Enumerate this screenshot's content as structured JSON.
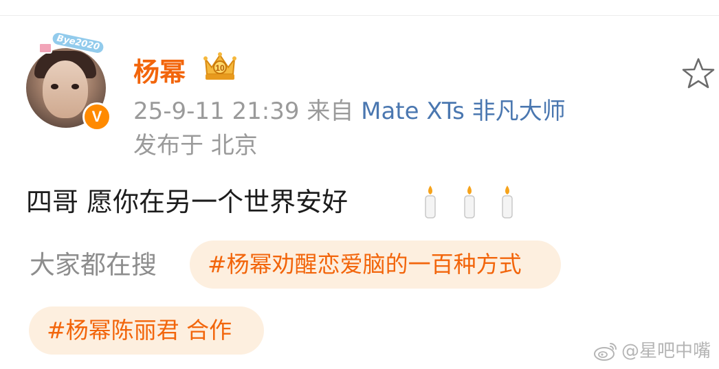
{
  "post": {
    "author": {
      "name": "杨幂",
      "avatar_sticker": "Bye2020",
      "verified_badge": "V",
      "badge_icon": "crown-level-icon"
    },
    "timestamp": "25-9-11  21:39",
    "source_prefix": "来自",
    "source_device": "Mate  XTs  非凡大师",
    "location": "发布于  北京",
    "text": "四哥  愿你在另一个世界安好",
    "emojis": [
      "candle",
      "candle",
      "candle"
    ],
    "favorite_icon": "star-outline-icon"
  },
  "trending": {
    "label": "大家都在搜",
    "tags": [
      "#杨幂劝醒恋爱脑的一百种方式",
      "#杨幂陈丽君  合作"
    ]
  },
  "watermark": {
    "text": "@星吧中嘴",
    "icon": "weibo-icon"
  },
  "colors": {
    "username": "#f2650b",
    "link": "#4a77b0",
    "meta": "#9a9a9a",
    "tag_bg": "#fdefdf",
    "tag_text": "#f2650b",
    "badge": "#ff8a00"
  }
}
